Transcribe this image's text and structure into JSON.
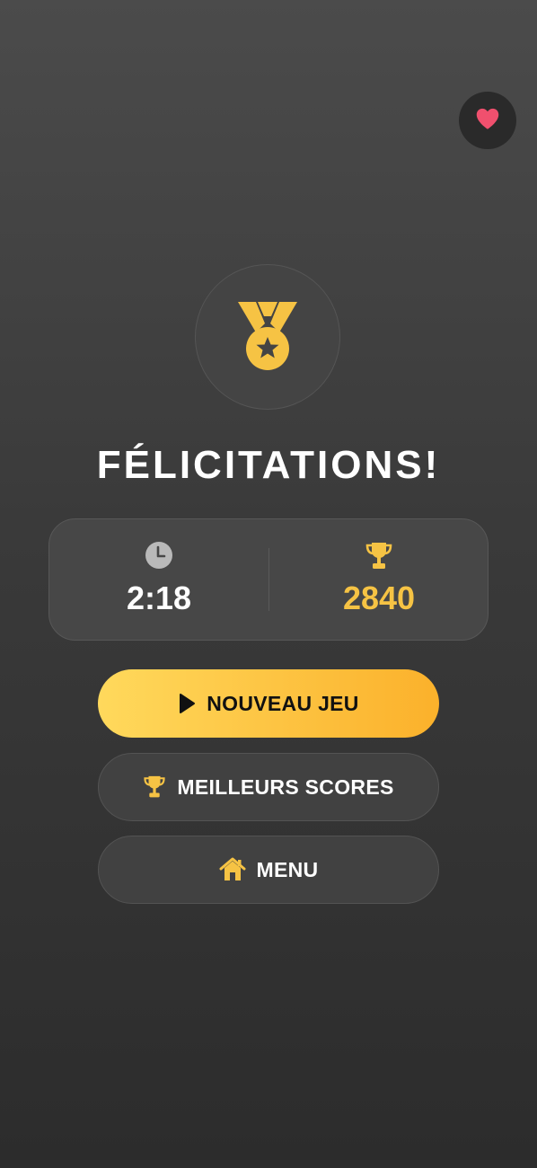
{
  "title": "FÉLICITATIONS!",
  "stats": {
    "time": "2:18",
    "score": "2840"
  },
  "buttons": {
    "new_game": "NOUVEAU JEU",
    "best_scores": "MEILLEURS SCORES",
    "menu": "MENU"
  },
  "icons": {
    "favorite": "heart-icon",
    "medal": "medal-icon",
    "time": "clock-icon",
    "score": "trophy-icon",
    "new_game": "play-icon",
    "best_scores": "trophy-icon",
    "menu": "home-icon"
  },
  "colors": {
    "accent": "#f6c344",
    "heart": "#f0506e",
    "primary_gradient_start": "#ffd95c",
    "primary_gradient_end": "#fbb12b"
  }
}
